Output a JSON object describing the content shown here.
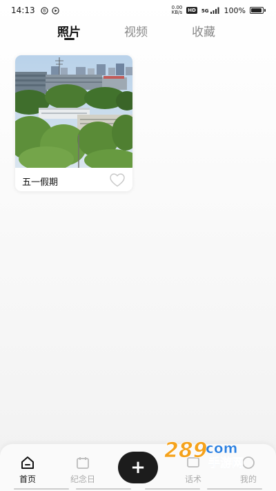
{
  "status_bar": {
    "time": "14:13",
    "net_speed_value": "0.00",
    "net_speed_unit": "KB/s",
    "hd_badge": "HD",
    "signal": "5G",
    "battery_text": "100%",
    "battery_level": 1.0
  },
  "tabs": [
    {
      "label": "照片",
      "active": true
    },
    {
      "label": "视频",
      "active": false
    },
    {
      "label": "收藏",
      "active": false
    }
  ],
  "album": {
    "title": "五一假期",
    "favorited": false
  },
  "bottom_nav": {
    "items": [
      {
        "label": "首页",
        "icon": "home-icon",
        "active": true
      },
      {
        "label": "纪念日",
        "icon": "calendar-icon",
        "active": false
      },
      {
        "label": "话术",
        "icon": "chat-icon",
        "active": false
      },
      {
        "label": "我的",
        "icon": "profile-icon",
        "active": false
      }
    ],
    "add_label": "+"
  },
  "watermark": {
    "brand": "289",
    "domain": "com",
    "tagline": "手游网"
  },
  "colors": {
    "accent_dark": "#1c1c1c",
    "inactive": "#aaaaaa",
    "watermark_orange": "#f5a21b",
    "watermark_blue": "#2a7fe0"
  }
}
